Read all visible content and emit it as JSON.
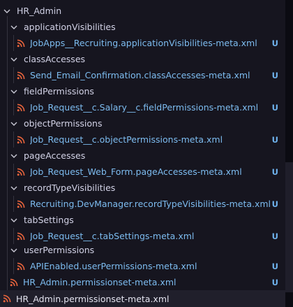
{
  "root": {
    "label": "HR_Admin",
    "expanded": true
  },
  "folders": [
    {
      "label": "applicationVisibilities",
      "file": "JobApps__Recruiting.applicationVisibilities-meta.xml",
      "status": "U"
    },
    {
      "label": "classAccesses",
      "file": "Send_Email_Confirmation.classAccesses-meta.xml",
      "status": "U"
    },
    {
      "label": "fieldPermissions",
      "file": "Job_Request__c.Salary__c.fieldPermissions-meta.xml",
      "status": "U"
    },
    {
      "label": "objectPermissions",
      "file": "Job_Request__c.objectPermissions-meta.xml",
      "status": "U"
    },
    {
      "label": "pageAccesses",
      "file": "Job_Request_Web_Form.pageAccesses-meta.xml",
      "status": "U"
    },
    {
      "label": "recordTypeVisibilities",
      "file": "Recruiting.DevManager.recordTypeVisibilities-meta.xml",
      "status": "U"
    },
    {
      "label": "tabSettings",
      "file": "Job_Request__c.tabSettings-meta.xml",
      "status": "U"
    },
    {
      "label": "userPermissions",
      "file": "APIEnabled.userPermissions-meta.xml",
      "status": "U"
    }
  ],
  "root_file": {
    "label": "HR_Admin.permissionset-meta.xml",
    "status": "U"
  },
  "outer_file": {
    "label": "HR_Admin.permissionset-meta.xml"
  },
  "colors": {
    "file_text": "#7dbcf0",
    "badge": "#6fb3ee",
    "rss_icon": "#e8643c",
    "panel": "#16151f"
  }
}
